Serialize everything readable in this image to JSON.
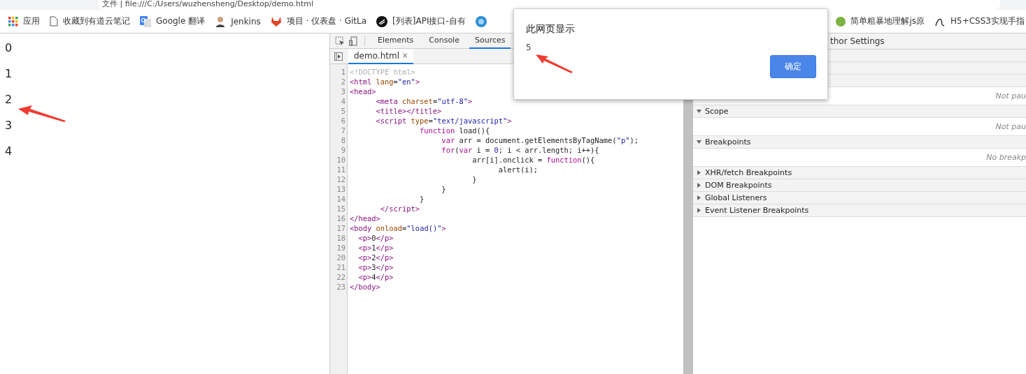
{
  "address_bar": {
    "text": "文件 | file:///C:/Users/wuzhensheng/Desktop/demo.html"
  },
  "bookmarks": [
    {
      "label": "应用",
      "kind": "apps"
    },
    {
      "label": "收藏到有道云笔记",
      "kind": "page"
    },
    {
      "label": "Google 翻译",
      "kind": "translate"
    },
    {
      "label": "Jenkins",
      "kind": "person"
    },
    {
      "label": "项目 · 仪表盘 · GitLa",
      "kind": "fox"
    },
    {
      "label": "[列表]API接口-自有",
      "kind": "dark"
    },
    {
      "kind": "globe"
    },
    {
      "label": "简单粗暴地理解js原",
      "kind": "green"
    },
    {
      "label": "H5+CSS3实现手指",
      "kind": "swirl"
    }
  ],
  "page_paragraphs": [
    "0",
    "1",
    "2",
    "3",
    "4"
  ],
  "devtools": {
    "tabs": [
      {
        "label": "Elements",
        "selected": false
      },
      {
        "label": "Console",
        "selected": false
      },
      {
        "label": "Sources",
        "selected": true
      }
    ],
    "file_tab": {
      "label": "demo.html",
      "close": "×"
    },
    "code_lines": [
      {
        "n": "1",
        "tokens": [
          {
            "kind": "doctype",
            "text": "<!DOCTYPE html>"
          }
        ]
      },
      {
        "n": "2",
        "tokens": [
          {
            "kind": "tag",
            "text": "<html "
          },
          {
            "kind": "attr",
            "text": "lang"
          },
          {
            "kind": "plain",
            "text": "="
          },
          {
            "kind": "str",
            "text": "\"en\""
          },
          {
            "kind": "tag",
            "text": ">"
          }
        ]
      },
      {
        "n": "3",
        "tokens": [
          {
            "kind": "tag",
            "text": "<head>"
          }
        ]
      },
      {
        "n": "4",
        "tokens": [
          {
            "kind": "tag",
            "text": "      <meta "
          },
          {
            "kind": "attr",
            "text": "charset"
          },
          {
            "kind": "plain",
            "text": "="
          },
          {
            "kind": "str",
            "text": "\"utf-8\""
          },
          {
            "kind": "tag",
            "text": ">"
          }
        ]
      },
      {
        "n": "5",
        "tokens": [
          {
            "kind": "tag",
            "text": "      <title></title>"
          }
        ]
      },
      {
        "n": "6",
        "tokens": [
          {
            "kind": "tag",
            "text": "      <script "
          },
          {
            "kind": "attr",
            "text": "type"
          },
          {
            "kind": "plain",
            "text": "="
          },
          {
            "kind": "str",
            "text": "\"text/javascript\""
          },
          {
            "kind": "tag",
            "text": ">"
          }
        ]
      },
      {
        "n": "7",
        "tokens": [
          {
            "kind": "kw",
            "text": "                function "
          },
          {
            "kind": "plain",
            "text": "load(){"
          }
        ]
      },
      {
        "n": "8",
        "tokens": [
          {
            "kind": "kw",
            "text": "                     var "
          },
          {
            "kind": "plain",
            "text": "arr = document.getElementsByTagName("
          },
          {
            "kind": "str",
            "text": "\"p\""
          },
          {
            "kind": "plain",
            "text": ");"
          }
        ]
      },
      {
        "n": "9",
        "tokens": [
          {
            "kind": "kw",
            "text": "                     for"
          },
          {
            "kind": "plain",
            "text": "("
          },
          {
            "kind": "kw",
            "text": "var "
          },
          {
            "kind": "plain",
            "text": "i = "
          },
          {
            "kind": "str",
            "text": "0"
          },
          {
            "kind": "plain",
            "text": "; i < arr.length; i++){"
          }
        ]
      },
      {
        "n": "10",
        "tokens": [
          {
            "kind": "plain",
            "text": "                            arr[i].onclick = "
          },
          {
            "kind": "kw",
            "text": "function"
          },
          {
            "kind": "plain",
            "text": "(){"
          }
        ]
      },
      {
        "n": "11",
        "tokens": [
          {
            "kind": "plain",
            "text": "                                  alert(i);"
          }
        ]
      },
      {
        "n": "12",
        "tokens": [
          {
            "kind": "plain",
            "text": "                            }"
          }
        ]
      },
      {
        "n": "13",
        "tokens": [
          {
            "kind": "plain",
            "text": "                     }"
          }
        ]
      },
      {
        "n": "14",
        "tokens": [
          {
            "kind": "plain",
            "text": "                }"
          }
        ]
      },
      {
        "n": "15",
        "tokens": [
          {
            "kind": "tag",
            "text": "       </script>"
          }
        ]
      },
      {
        "n": "16",
        "tokens": [
          {
            "kind": "tag",
            "text": "</head>"
          }
        ]
      },
      {
        "n": "17",
        "tokens": [
          {
            "kind": "tag",
            "text": "<body "
          },
          {
            "kind": "attr",
            "text": "onload"
          },
          {
            "kind": "plain",
            "text": "="
          },
          {
            "kind": "str",
            "text": "\"load()\""
          },
          {
            "kind": "tag",
            "text": ">"
          }
        ]
      },
      {
        "n": "18",
        "tokens": [
          {
            "kind": "tag",
            "text": "  <p>"
          },
          {
            "kind": "plain",
            "text": "0"
          },
          {
            "kind": "tag",
            "text": "</p>"
          }
        ]
      },
      {
        "n": "19",
        "tokens": [
          {
            "kind": "tag",
            "text": "  <p>"
          },
          {
            "kind": "plain",
            "text": "1"
          },
          {
            "kind": "tag",
            "text": "</p>"
          }
        ]
      },
      {
        "n": "20",
        "tokens": [
          {
            "kind": "tag",
            "text": "  <p>"
          },
          {
            "kind": "plain",
            "text": "2"
          },
          {
            "kind": "tag",
            "text": "</p>"
          }
        ]
      },
      {
        "n": "21",
        "tokens": [
          {
            "kind": "tag",
            "text": "  <p>"
          },
          {
            "kind": "plain",
            "text": "3"
          },
          {
            "kind": "tag",
            "text": "</p>"
          }
        ]
      },
      {
        "n": "22",
        "tokens": [
          {
            "kind": "tag",
            "text": "  <p>"
          },
          {
            "kind": "plain",
            "text": "4"
          },
          {
            "kind": "tag",
            "text": "</p>"
          }
        ]
      },
      {
        "n": "23",
        "tokens": [
          {
            "kind": "tag",
            "text": "</body>"
          }
        ]
      }
    ],
    "debugger": {
      "header": "thor Settings",
      "sections": [
        {
          "kind": "blank"
        },
        {
          "kind": "blank"
        },
        {
          "kind": "blank"
        },
        {
          "kind": "note",
          "text": "Not pau"
        },
        {
          "kind": "header",
          "title": "Scope",
          "expanded": true
        },
        {
          "kind": "note",
          "text": "Not pau"
        },
        {
          "kind": "header",
          "title": "Breakpoints",
          "expanded": true
        },
        {
          "kind": "note",
          "text": "No breakp"
        },
        {
          "kind": "header",
          "title": "XHR/fetch Breakpoints",
          "expanded": false
        },
        {
          "kind": "header",
          "title": "DOM Breakpoints",
          "expanded": false
        },
        {
          "kind": "header",
          "title": "Global Listeners",
          "expanded": false
        },
        {
          "kind": "header",
          "title": "Event Listener Breakpoints",
          "expanded": false
        }
      ]
    }
  },
  "dialog": {
    "title": "此网页显示",
    "message": "5",
    "button": "确定"
  }
}
